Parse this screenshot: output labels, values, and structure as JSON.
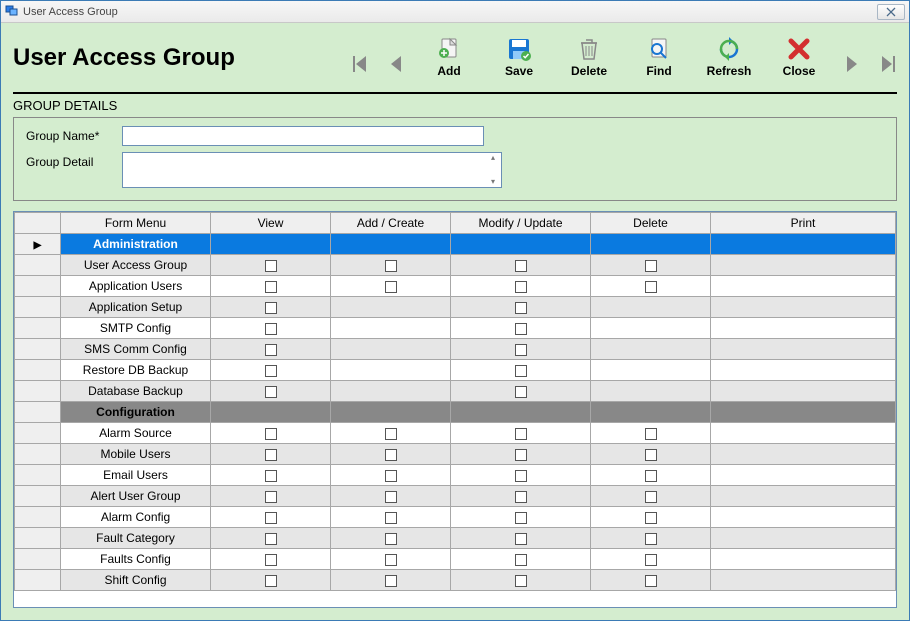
{
  "window": {
    "title": "User Access Group"
  },
  "header": {
    "title": "User Access Group"
  },
  "toolbar": {
    "add": "Add",
    "save": "Save",
    "delete": "Delete",
    "find": "Find",
    "refresh": "Refresh",
    "close": "Close"
  },
  "section": {
    "label": "GROUP DETAILS"
  },
  "form": {
    "group_name_label": "Group Name*",
    "group_name_value": "",
    "group_detail_label": "Group Detail",
    "group_detail_value": ""
  },
  "grid": {
    "headers": {
      "form_menu": "Form Menu",
      "view": "View",
      "add": "Add / Create",
      "modify": "Modify / Update",
      "delete": "Delete",
      "print": "Print"
    },
    "rows": [
      {
        "type": "section",
        "style": "blue",
        "label": "Administration",
        "selected": true
      },
      {
        "type": "item",
        "label": "User Access Group",
        "view": true,
        "add": true,
        "modify": true,
        "delete": true,
        "print": false
      },
      {
        "type": "item",
        "label": "Application Users",
        "view": true,
        "add": true,
        "modify": true,
        "delete": true,
        "print": false
      },
      {
        "type": "item",
        "label": "Application Setup",
        "view": true,
        "add": false,
        "modify": true,
        "delete": false,
        "print": false
      },
      {
        "type": "item",
        "label": "SMTP Config",
        "view": true,
        "add": false,
        "modify": true,
        "delete": false,
        "print": false
      },
      {
        "type": "item",
        "label": "SMS Comm Config",
        "view": true,
        "add": false,
        "modify": true,
        "delete": false,
        "print": false
      },
      {
        "type": "item",
        "label": "Restore DB Backup",
        "view": true,
        "add": false,
        "modify": true,
        "delete": false,
        "print": false
      },
      {
        "type": "item",
        "label": "Database Backup",
        "view": true,
        "add": false,
        "modify": true,
        "delete": false,
        "print": false
      },
      {
        "type": "section",
        "style": "gray",
        "label": "Configuration"
      },
      {
        "type": "item",
        "label": "Alarm Source",
        "view": true,
        "add": true,
        "modify": true,
        "delete": true,
        "print": false
      },
      {
        "type": "item",
        "label": "Mobile Users",
        "view": true,
        "add": true,
        "modify": true,
        "delete": true,
        "print": false
      },
      {
        "type": "item",
        "label": "Email  Users",
        "view": true,
        "add": true,
        "modify": true,
        "delete": true,
        "print": false
      },
      {
        "type": "item",
        "label": "Alert User Group",
        "view": true,
        "add": true,
        "modify": true,
        "delete": true,
        "print": false
      },
      {
        "type": "item",
        "label": "Alarm Config",
        "view": true,
        "add": true,
        "modify": true,
        "delete": true,
        "print": false
      },
      {
        "type": "item",
        "label": "Fault Category",
        "view": true,
        "add": true,
        "modify": true,
        "delete": true,
        "print": false
      },
      {
        "type": "item",
        "label": "Faults Config",
        "view": true,
        "add": true,
        "modify": true,
        "delete": true,
        "print": false
      },
      {
        "type": "item",
        "label": "Shift Config",
        "view": true,
        "add": true,
        "modify": true,
        "delete": true,
        "print": false
      }
    ]
  }
}
